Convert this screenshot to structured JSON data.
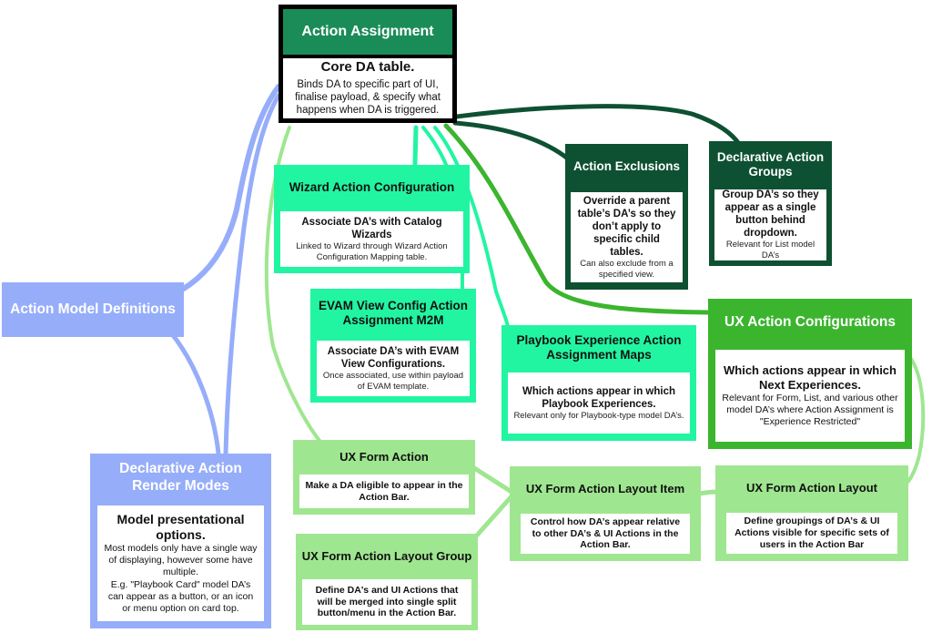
{
  "colors": {
    "core": "#1a8c57",
    "teal": "#22f5a2",
    "dark_green": "#0e5132",
    "bright_green": "#3bb52e",
    "light_green": "#9fe690",
    "blue": "#96adfa",
    "outline": "#000000"
  },
  "nodes": {
    "action_assignment": {
      "title": "Action Assignment",
      "lead": "Core DA table.",
      "note": "Binds DA to specific part of UI, finalise payload,  & specify what happens when DA is triggered."
    },
    "wizard_action_configuration": {
      "title": "Wizard Action Configuration",
      "lead": "Associate DA’s with Catalog Wizards",
      "note": "Linked to Wizard through Wizard Action Configuration Mapping table."
    },
    "evam_view_config": {
      "title": "EVAM View Config Action Assignment M2M",
      "lead": "Associate DA’s with EVAM View Configurations.",
      "note": "Once associated, use within payload of EVAM template."
    },
    "playbook_experience": {
      "title": "Playbook Experience Action Assignment Maps",
      "lead": "Which actions appear in which Playbook Experiences.",
      "note": "Relevant only for Playbook-type model DA’s."
    },
    "action_exclusions": {
      "title": "Action Exclusions",
      "lead": "Override a parent table’s DA’s so they don’t apply to specific child tables.",
      "note": "Can also exclude from a specified view."
    },
    "declarative_action_groups": {
      "title": "Declarative Action Groups",
      "lead": "Group DA’s so they appear as a single button behind  dropdown.",
      "note": "Relevant for List model DA’s"
    },
    "ux_action_configurations": {
      "title": "UX Action Configurations",
      "lead": "Which actions appear in which Next Experiences.",
      "note": "Relevant for Form, List, and various other model DA’s where Action Assignment is \"Experience Restricted\""
    },
    "action_model_definitions": {
      "title": "Action Model Definitions"
    },
    "declarative_action_render_modes": {
      "title": "Declarative Action Render Modes",
      "lead": "Model presentational options.",
      "note": "Most models only have a single way of displaying, however some have multiple.",
      "note2": "E.g. \"Playbook Card\" model DA’s can appear as a button, or an icon or menu option on card top."
    },
    "ux_form_action": {
      "title": "UX Form Action",
      "lead": "Make a DA eligible to appear in the Action Bar."
    },
    "ux_form_action_layout_group": {
      "title": "UX Form Action Layout Group",
      "lead": "Define DA's and UI Actions that will be merged into single split button/menu in the Action Bar."
    },
    "ux_form_action_layout_item": {
      "title": "UX Form Action Layout Item",
      "lead": "Control how DA’s appear relative to other DA’s & UI Actions in the Action Bar."
    },
    "ux_form_action_layout": {
      "title": "UX Form Action Layout",
      "lead": "Define groupings of DA’s & UI Actions visible for specific sets of users in the Action Bar"
    }
  },
  "edges": [
    {
      "from": "action_assignment",
      "to": "action_model_definitions",
      "color": "blue"
    },
    {
      "from": "action_assignment",
      "to": "declarative_action_render_modes",
      "color": "blue"
    },
    {
      "from": "action_model_definitions",
      "to": "declarative_action_render_modes",
      "color": "blue"
    },
    {
      "from": "action_assignment",
      "to": "ux_form_action",
      "color": "light_green"
    },
    {
      "from": "action_assignment",
      "to": "wizard_action_configuration",
      "color": "teal"
    },
    {
      "from": "action_assignment",
      "to": "evam_view_config",
      "color": "teal"
    },
    {
      "from": "action_assignment",
      "to": "playbook_experience",
      "color": "teal"
    },
    {
      "from": "action_assignment",
      "to": "ux_action_configurations",
      "color": "bright_green"
    },
    {
      "from": "action_assignment",
      "to": "action_exclusions",
      "color": "dark_green"
    },
    {
      "from": "action_assignment",
      "to": "declarative_action_groups",
      "color": "dark_green"
    },
    {
      "from": "ux_form_action",
      "to": "ux_form_action_layout_item",
      "color": "light_green"
    },
    {
      "from": "ux_form_action_layout_group",
      "to": "ux_form_action_layout_item",
      "color": "light_green"
    },
    {
      "from": "ux_form_action_layout_item",
      "to": "ux_form_action_layout",
      "color": "light_green"
    },
    {
      "from": "ux_action_configurations",
      "to": "ux_form_action_layout",
      "color": "light_green"
    }
  ]
}
